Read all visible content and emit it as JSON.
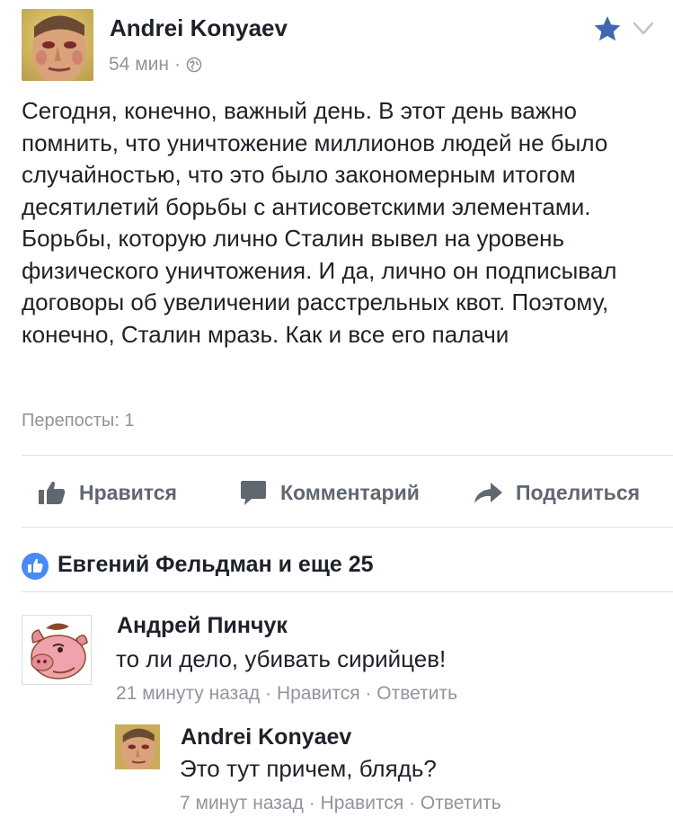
{
  "post": {
    "author": "Andrei Konyaev",
    "time": "54 мин",
    "meta_sep": "·",
    "privacy_icon": "globe-icon",
    "text": "Сегодня, конечно, важный день. В этот день важно помнить, что уничтожение миллионов людей не было случайностью, что это было закономерным итогом десятилетий борьбы с антисоветскими элементами. Борьбы, которую лично Сталин вывел на уровень физического уничтожения. И да, лично он подписывал договоры об увеличении расстрельных квот. Поэтому, конечно, Сталин мразь. Как и все его палачи",
    "reposts": "Перепосты: 1"
  },
  "actions": {
    "like": "Нравится",
    "comment": "Комментарий",
    "share": "Поделиться"
  },
  "likes": {
    "text": "Евгений Фельдман и еще 25"
  },
  "comments": [
    {
      "name": "Андрей Пинчук",
      "text": "то ли дело, убивать сирийцев!",
      "time": "21 минуту назад",
      "like": "Нравится",
      "reply": "Ответить",
      "sep": "·"
    },
    {
      "name": "Andrei Konyaev",
      "text": "Это тут причем, блядь?",
      "time": "7 минут назад",
      "like": "Нравится",
      "reply": "Ответить",
      "sep": "·"
    }
  ],
  "colors": {
    "accent": "#4a8af4",
    "text": "#1d2129",
    "muted": "#90949c",
    "action": "#606770"
  }
}
